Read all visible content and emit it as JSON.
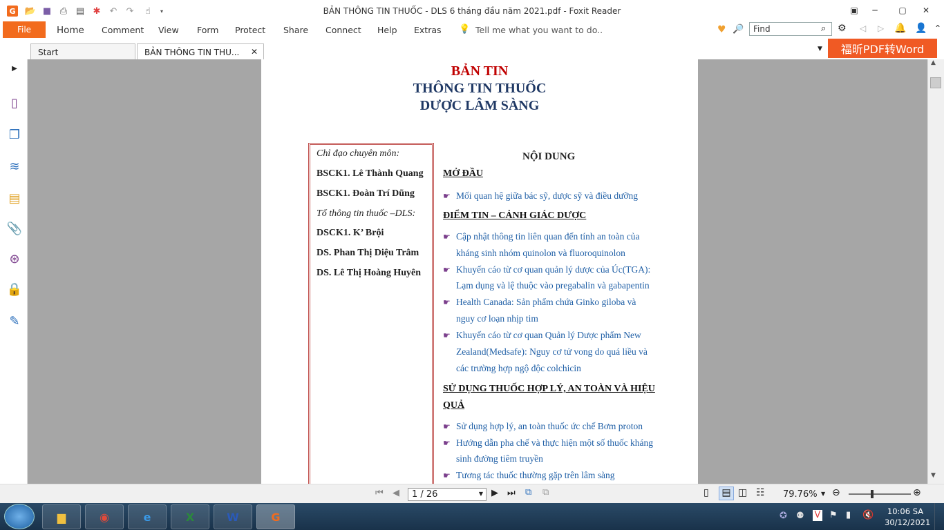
{
  "window": {
    "title": "BẢN THÔNG TIN THUỐC - DLS 6 tháng đầu năm 2021.pdf - Foxit Reader"
  },
  "ribbon": {
    "file": "File",
    "tabs": [
      "Home",
      "Comment",
      "View",
      "Form",
      "Protect",
      "Share",
      "Connect",
      "Help",
      "Extras"
    ],
    "tell": "Tell me what you want to do..",
    "find_placeholder": "Find"
  },
  "tabs": {
    "start": "Start",
    "doc": "BẢN THÔNG TIN THU..."
  },
  "ad": "福昕PDF转Word",
  "doc": {
    "h1": "BẢN TIN",
    "h2": "THÔNG TIN THUỐC",
    "h3": "DƯỢC LÂM SÀNG",
    "left": {
      "label1": "Chỉ đạo chuyên môn:",
      "p1": "BSCK1. Lê Thành Quang",
      "p2": "BSCK1. Đoàn Trí Dũng",
      "label2": "Tổ thông tin thuốc –DLS:",
      "p3": "DSCK1. K’ Brội",
      "p4": "DS. Phan Thị Diệu Trâm",
      "p5": "DS. Lê Thị Hoàng Huyên"
    },
    "content_title": "NỘI DUNG",
    "sec1": "MỞ ĐẦU",
    "b1": "Mối quan hệ giữa bác sỹ, dược sỹ và điều dưỡng",
    "sec2": "ĐIỂM TIN – CẢNH GIÁC DƯỢC",
    "b2a": "Cập nhật thông tin liên quan đến tính an toàn của",
    "b2b": "kháng sinh nhóm quinolon và fluoroquinolon",
    "b3a": "Khuyến cáo từ cơ quan quản lý dược của Úc(TGA):",
    "b3b": "Lạm dụng và lệ thuộc vào pregabalin và gabapentin",
    "b4a": "Health Canada: Sản phẩm chứa Ginko giloba và",
    "b4b": "nguy cơ loạn nhịp tim",
    "b5a": "Khuyến cáo từ cơ quan Quản lý Dược phẩm New",
    "b5b": "Zealand(Medsafe): Nguy cơ tử vong do quá liều và",
    "b5c": "các trường hợp ngộ độc colchicin",
    "sec3a": "SỬ DỤNG THUỐC HỢP LÝ, AN TOÀN VÀ HIỆU",
    "sec3b": "QUẢ",
    "b6": "Sử dụng hợp lý, an toàn thuốc ức chế Bơm proton",
    "b7a": "Hướng dẫn pha chế và thực hiện một số thuốc kháng",
    "b7b": "sinh đường tiêm truyền",
    "b8": "Tương tác thuốc thường gặp trên lâm sàng"
  },
  "status": {
    "page": "1 / 26",
    "zoom": "79.76%"
  },
  "clock": {
    "time": "10:06 SA",
    "date": "30/12/2021"
  },
  "colors": {
    "accent": "#f26b1d",
    "title_red": "#c00000",
    "title_blue": "#1f3864",
    "link_blue": "#1f5fa6"
  }
}
